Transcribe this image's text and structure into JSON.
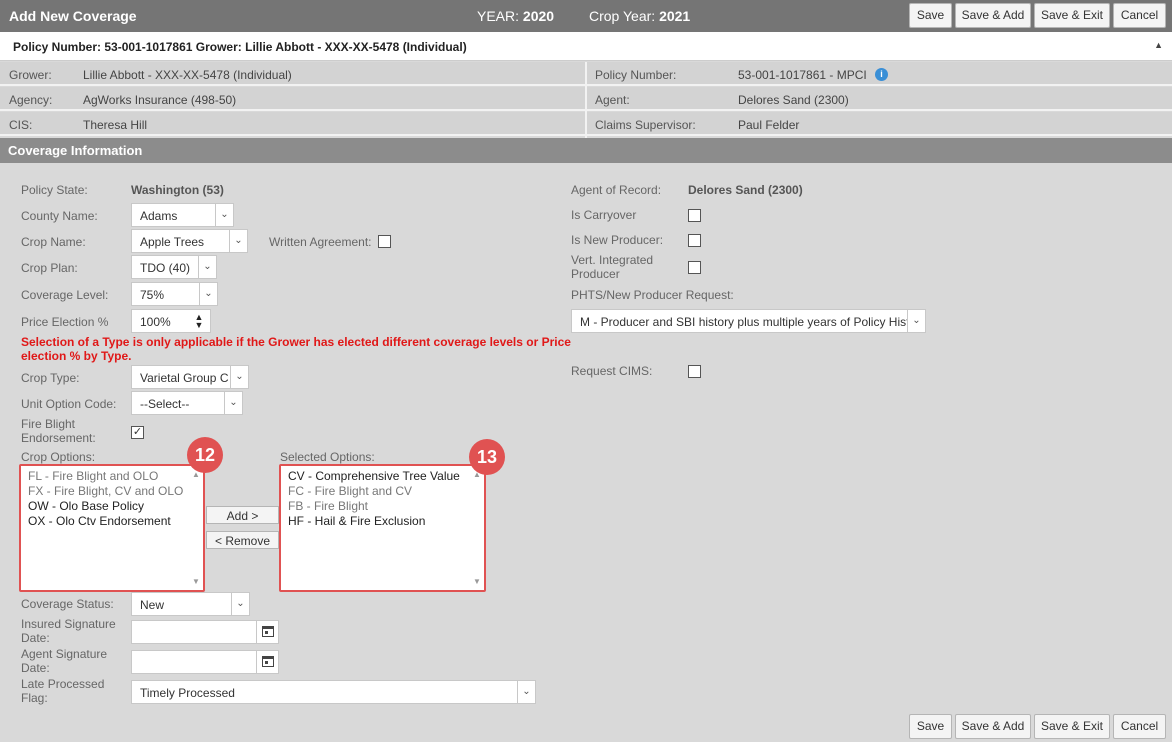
{
  "header": {
    "title": "Add New Coverage",
    "year_label": "YEAR:",
    "year_value": "2020",
    "crop_year_label": "Crop Year:",
    "crop_year_value": "2021",
    "buttons": {
      "save": "Save",
      "save_add": "Save & Add",
      "save_exit": "Save & Exit",
      "cancel": "Cancel"
    }
  },
  "policy_bar": {
    "text": "Policy Number: 53-001-1017861 Grower: Lillie Abbott - XXX-XX-5478 (Individual)",
    "caret": "▲"
  },
  "info": {
    "grower_label": "Grower:",
    "grower_value": "Lillie Abbott - XXX-XX-5478 (Individual)",
    "agency_label": "Agency:",
    "agency_value": "AgWorks Insurance (498-50)",
    "cis_label": "CIS:",
    "cis_value": "Theresa Hill",
    "policy_label": "Policy Number:",
    "policy_value": "53-001-1017861 - MPCI",
    "agent_label": "Agent:",
    "agent_value": "Delores Sand (2300)",
    "claims_label": "Claims Supervisor:",
    "claims_value": "Paul Felder"
  },
  "section_title": "Coverage Information",
  "form": {
    "policy_state_label": "Policy State:",
    "policy_state_value": "Washington (53)",
    "county_label": "County Name:",
    "county_value": "Adams",
    "crop_name_label": "Crop Name:",
    "crop_name_value": "Apple Trees",
    "written_agreement_label": "Written Agreement:",
    "crop_plan_label": "Crop Plan:",
    "crop_plan_value": "TDO (40)",
    "coverage_level_label": "Coverage Level:",
    "coverage_level_value": "75%",
    "price_election_label": "Price Election %",
    "price_election_value": "100%",
    "warning": "Selection of a Type is only applicable if the Grower has elected different coverage levels or Price election % by Type.",
    "crop_type_label": "Crop Type:",
    "crop_type_value": "Varietal Group C",
    "unit_option_label": "Unit Option Code:",
    "unit_option_value": "--Select--",
    "fire_blight_label": "Fire Blight Endorsement:",
    "fire_blight_checked": true,
    "crop_options_label": "Crop Options:",
    "crop_options": [
      {
        "text": "FL - Fire Blight and OLO",
        "dim": true
      },
      {
        "text": "FX - Fire Blight, CV and OLO",
        "dim": true
      },
      {
        "text": "OW - Olo Base Policy",
        "dim": false
      },
      {
        "text": "OX - Olo Ctv Endorsement",
        "dim": false
      }
    ],
    "selected_options_label": "Selected Options:",
    "selected_options": [
      {
        "text": "CV - Comprehensive Tree Value",
        "dim": false
      },
      {
        "text": "FC - Fire Blight and CV",
        "dim": true
      },
      {
        "text": "FB - Fire Blight",
        "dim": true
      },
      {
        "text": "HF - Hail & Fire Exclusion",
        "dim": false
      }
    ],
    "add_button": "Add >",
    "remove_button": "< Remove",
    "badge_12": "12",
    "badge_13": "13",
    "coverage_status_label": "Coverage Status:",
    "coverage_status_value": "New",
    "insured_sig_label": "Insured Signature Date:",
    "agent_sig_label": "Agent Signature Date:",
    "late_flag_label": "Late Processed Flag:",
    "late_flag_value": "Timely Processed",
    "agent_of_record_label": "Agent of Record:",
    "agent_of_record_value": "Delores Sand (2300)",
    "carryover_label": "Is Carryover",
    "new_producer_label": "Is New Producer:",
    "vert_integrated_label": "Vert. Integrated Producer",
    "phts_label": "PHTS/New Producer Request:",
    "phts_value": "M - Producer and SBI history plus multiple years of Policy History",
    "request_cims_label": "Request CIMS:"
  },
  "colors": {
    "header_bg": "#757575",
    "section_bg": "#8c8c8c",
    "highlight": "#e05252",
    "warning": "#e01818"
  }
}
